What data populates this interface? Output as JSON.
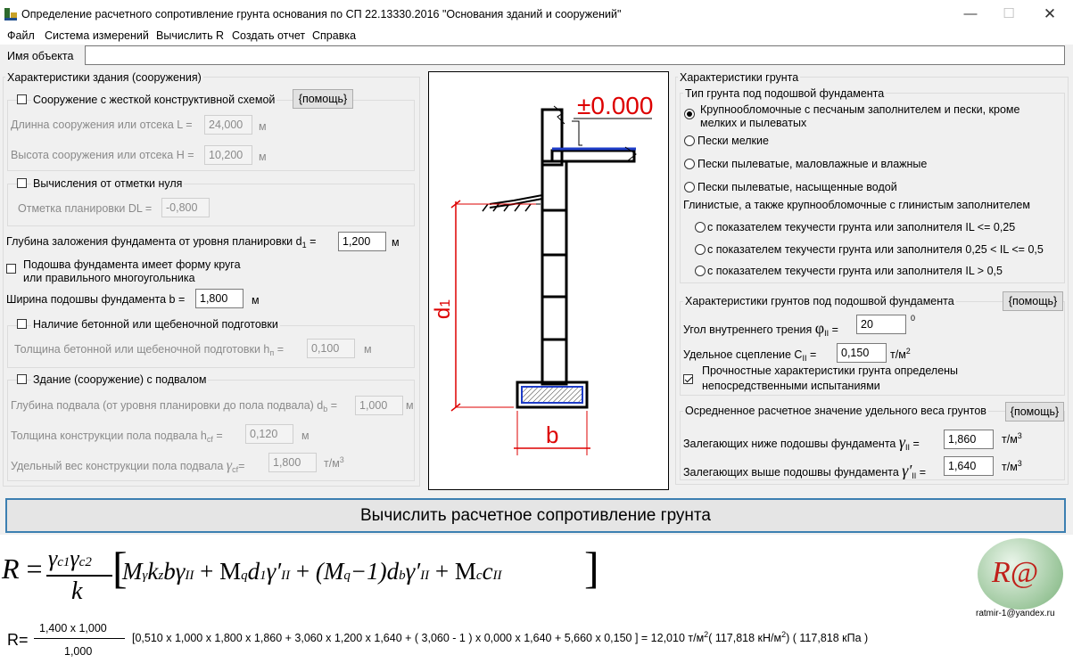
{
  "window": {
    "title": "Определение расчетного сопротивление грунта основания по СП 22.13330.2016  \"Основания зданий и сооружений\"",
    "app_icon": "app-icon"
  },
  "menu": [
    "Файл",
    "Система измерений",
    "Вычислить R",
    "Создать отчет",
    "Справка"
  ],
  "object": {
    "label": "Имя объекта",
    "value": ""
  },
  "building": {
    "title": "Характеристики  здания (сооружения)",
    "rigid_label": "Сооружение с жесткой конструктивной схемой",
    "help": "{помощь}",
    "length_label": "Длинна сооружения или отсека L =",
    "length_value": "24,000",
    "length_unit": "м",
    "height_label": "Высота сооружения или отсека H =",
    "height_value": "10,200",
    "height_unit": "м",
    "zero_label": "Вычисления от отметки нуля",
    "dl_label": "Отметка планировки DL =",
    "dl_value": "-0,800",
    "depth_label": "Глубина заложения фундамента от уровня планировки  d",
    "depth_sub": "1",
    "depth_eq": "=",
    "depth_value": "1,200",
    "depth_unit": "м",
    "circle_label_1": "Подошва фундамента имеет форму круга",
    "circle_label_2": "или правильного многоугольника",
    "width_label": "Ширина подошвы фундамента b =",
    "width_value": "1,800",
    "width_unit": "м",
    "prep_label": "Наличие бетонной или щебеночной подготовки",
    "prep_th_label": "Толщина бетонной или щебеночной подготовки  h",
    "prep_th_sub": "п",
    "prep_th_eq": "=",
    "prep_th_value": "0,100",
    "prep_th_unit": "м",
    "basement_label": "Здание (сооружение) с подвалом",
    "bas_depth_label": "Глубина подвала (от уровня планировки до пола подвала) d",
    "bas_depth_sub": "b",
    "bas_depth_eq": "=",
    "bas_depth_value": "1,000",
    "bas_depth_unit": "м",
    "floor_th_label": "Толщина конструкции пола подвала   h",
    "floor_th_sub": "cf",
    "floor_th_eq": "=",
    "floor_th_value": "0,120",
    "floor_th_unit": "м",
    "floor_w_label": "Удельный вес конструкции пола подвала",
    "floor_w_gamma": "γ",
    "floor_w_sub": "cf",
    "floor_w_eq": "=",
    "floor_w_value": "1,800",
    "floor_w_unit": "т/м",
    "floor_w_unit_sup": "3"
  },
  "diagram": {
    "elevation": "±0.000",
    "d_label": "d",
    "d_sub": "1",
    "b_label": "b"
  },
  "soil": {
    "title": "Характеристики грунта",
    "type_title": "Тип грунта под подошвой фундамента",
    "types": [
      "Крупнообломочные с песчаным заполнителем и пески, кроме",
      "мелких и пылеватых",
      "Пески мелкие",
      "Пески пылеватые, маловлажные и влажные",
      "Пески пылеватые, насыщенные водой"
    ],
    "clay_title": "Глинистые, а также крупнообломочные с глинистым заполнителем",
    "clay_options": [
      "с показателем текучести грунта или заполнителя IL <= 0,25",
      "с показателем текучести грунта или заполнителя 0,25 < IL <= 0,5",
      "с показателем текучести грунта или заполнителя IL > 0,5"
    ],
    "chars_title": "Характеристики грунтов под подошвой фундамента",
    "help": "{помощь}",
    "phi_label": "Угол внутреннего трения",
    "phi_symbol": "φ",
    "phi_sub": "II",
    "phi_eq": "=",
    "phi_value": "20",
    "phi_unit": "0",
    "c_label": "Удельное сцепление   C",
    "c_sub": "II",
    "c_eq": "=",
    "c_value": "0,150",
    "c_unit": "т/м",
    "c_unit_sup": "2",
    "tested_label_1": "Прочностные характеристики грунта определены",
    "tested_label_2": "непосредственными испытаниями",
    "avg_title": "Осредненное расчетное значение удельного веса грунтов",
    "below_label": "Залегающих ниже подошвы фундамента",
    "below_gamma": "γ",
    "below_sub": "II",
    "below_eq": "=",
    "below_value": "1,860",
    "below_unit": "т/м",
    "below_unit_sup": "3",
    "above_label": "Залегающих выше подошвы фундамента",
    "above_gamma": "γ′",
    "above_sub": "II",
    "above_eq": "=",
    "above_value": "1,640",
    "above_unit": "т/м",
    "above_unit_sup": "3"
  },
  "calc_button": "Вычислить расчетное сопротивление грунта",
  "formula": {
    "R": "R",
    "eq": "=",
    "num_gamma_c1": "γ",
    "num_sub_c1": "c1",
    "num_gamma_c2": "γ",
    "num_sub_c2": "c2",
    "den_k": "k",
    "bracket_body": "M",
    "term1_M_sub": "γ",
    "term1_rest": "k",
    "term1_z": "z",
    "term1_b": "bγ",
    "term1_II": "II",
    "plus1": "+ M",
    "term2_sub": "q",
    "term2_d": "d",
    "term2_d_sub": "1",
    "term2_g": "γ′",
    "term2_II": "II",
    "plus2": "+",
    "term3_open": "(M",
    "term3_sub": "q",
    "term3_close": "−1)",
    "term3_d": "d",
    "term3_d_sub": "b",
    "term3_g": "γ′",
    "term3_II": "II",
    "plus3": "+ M",
    "term4_sub": "c",
    "term4_c": "c",
    "term4_II": "II",
    "result_R": "R=",
    "result_num": "1,400 x 1,000",
    "result_den": "1,000",
    "result_body": "[0,510 x 1,000 x 1,800 x 1,860 + 3,060 x 1,200 x 1,640 + ( 3,060 - 1 ) x 0,000 x 1,640 + 5,660 x 0,150 ] = 12,010 т/м",
    "result_sup1": "2",
    "result_mid": "( 117,818 кН/м",
    "result_sup2": "2",
    "result_end": ") ( 117,818 кПа )"
  },
  "logo": {
    "text": "R@",
    "email": "ratmir-1@yandex.ru"
  }
}
